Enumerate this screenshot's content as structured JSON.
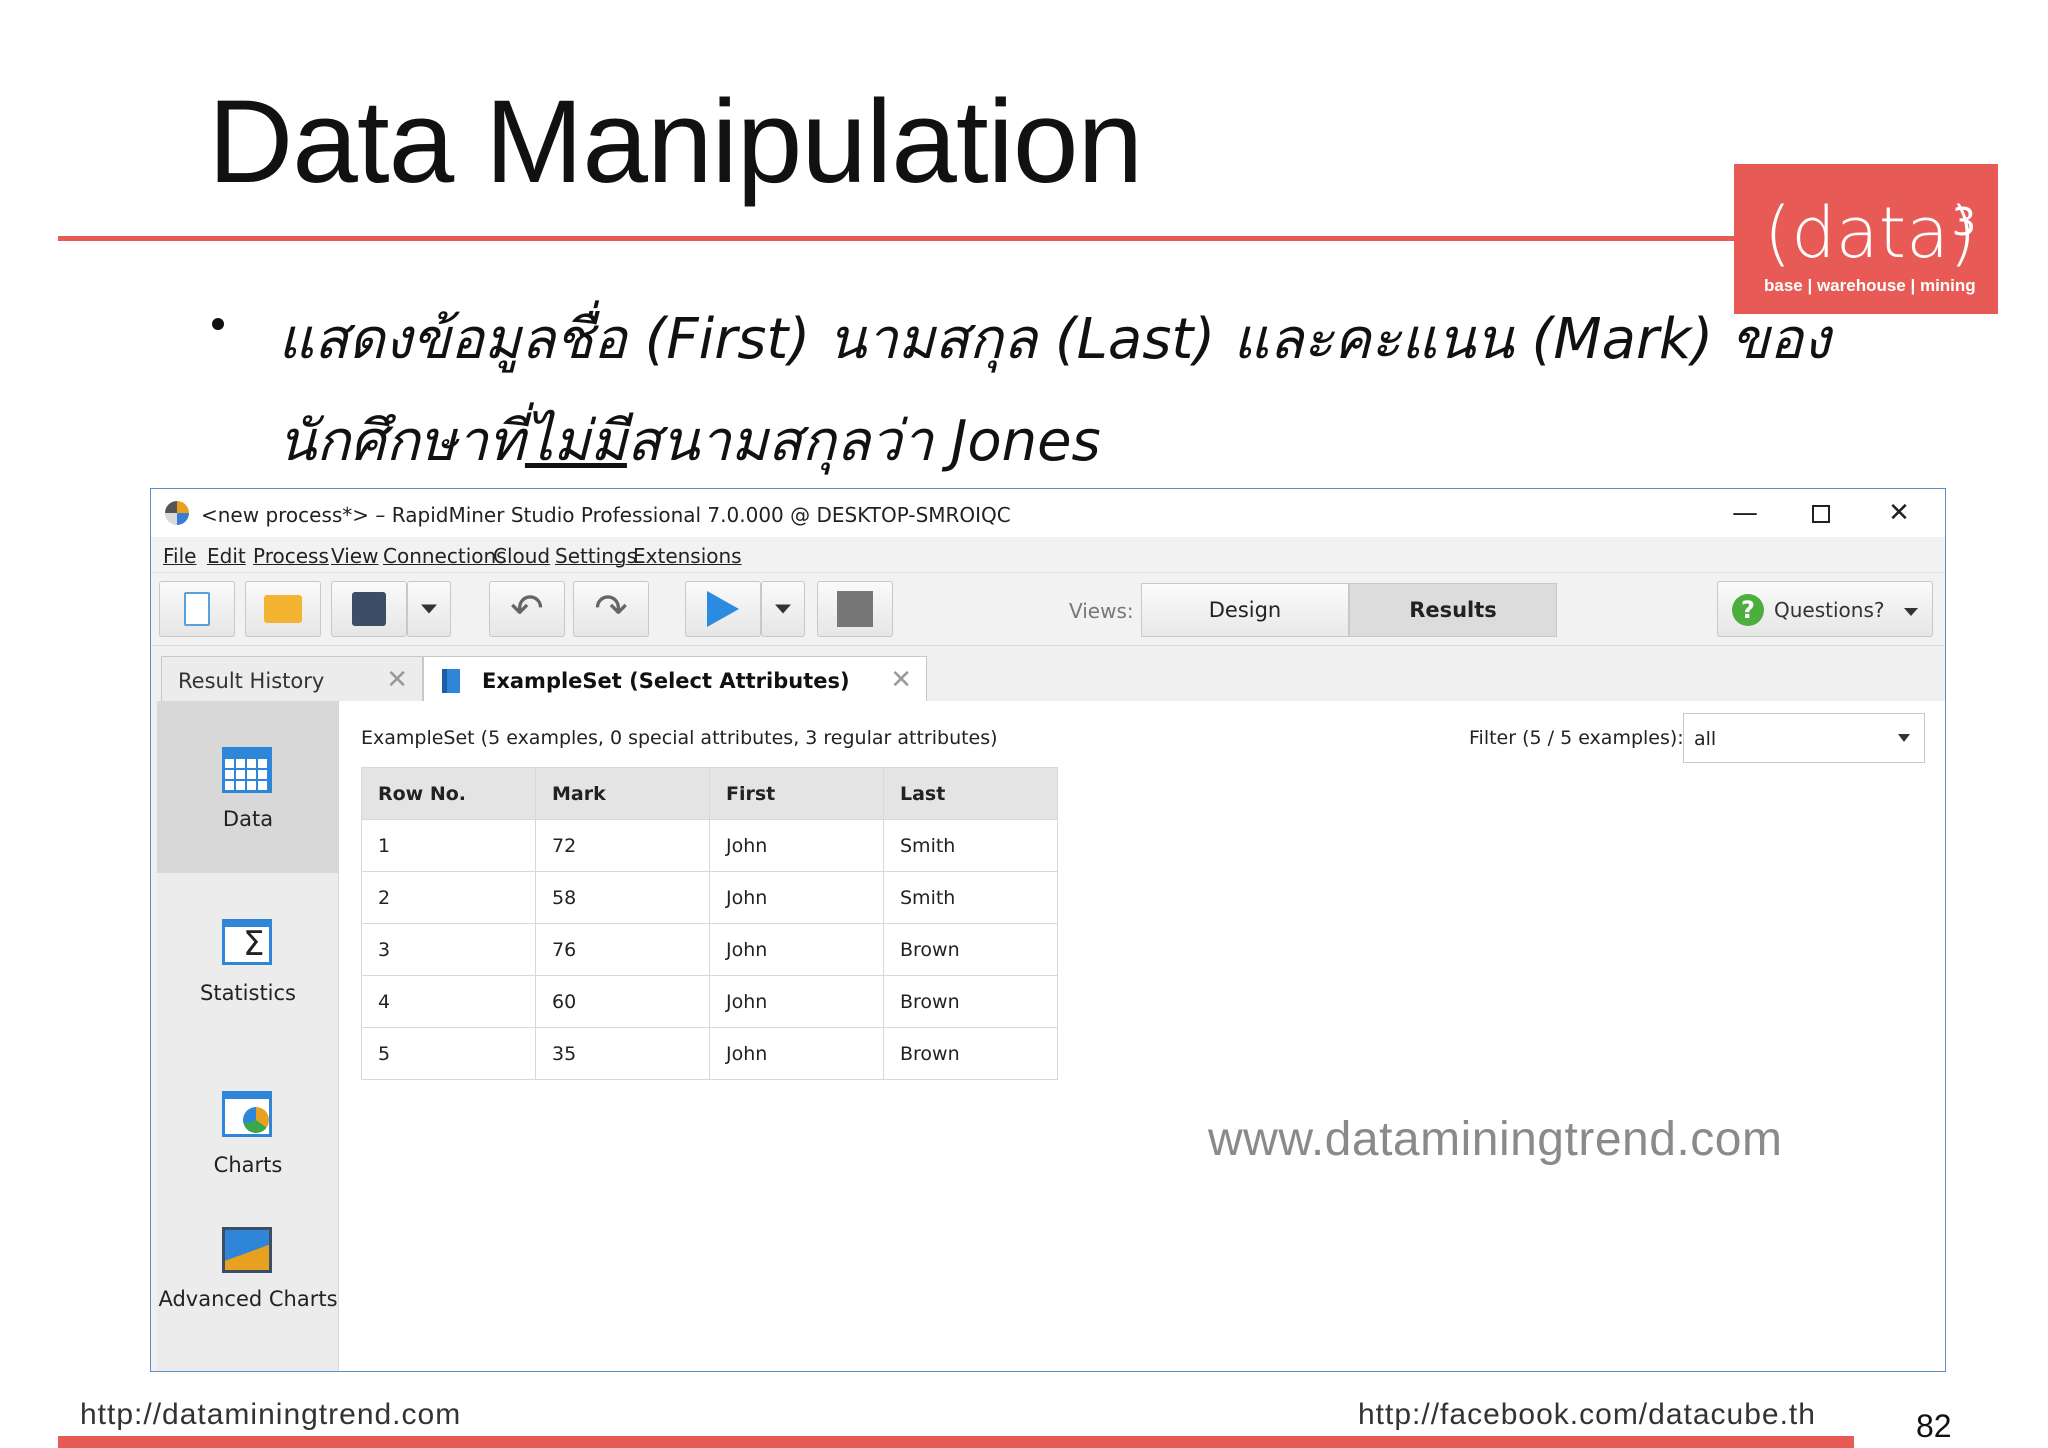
{
  "slide": {
    "title": "Data Manipulation",
    "logo": {
      "main": "(data)",
      "sup": "3",
      "sub": "base | warehouse | mining"
    },
    "bullet_line1": "แสดงข้อมูลชื่อ (First) นามสกุล (Last) และคะแนน (Mark) ของ",
    "bullet_line2_pre": "นักศึกษาที่",
    "bullet_line2_under": "ไม่มี",
    "bullet_line2_post": "สนามสกุลว่า Jones",
    "watermark": "www.dataminingtrend.com",
    "footer_left": "http://dataminingtrend.com",
    "footer_right": "http://facebook.com/datacube.th",
    "page_number": "82",
    "accent_color": "#e85a55"
  },
  "window": {
    "title": "<new process*> – RapidMiner Studio Professional 7.0.000 @ DESKTOP-SMROIQC",
    "controls": {
      "minimize": "—",
      "close": "✕"
    },
    "menu": [
      "File",
      "Edit",
      "Process",
      "View",
      "Connections",
      "Cloud",
      "Settings",
      "Extensions"
    ],
    "toolbar": {
      "undo_glyph": "↶",
      "redo_glyph": "↷",
      "views_label": "Views:",
      "design_label": "Design",
      "results_label": "Results",
      "questions_label": "Questions?",
      "questions_glyph": "?"
    },
    "tabs": {
      "history_label": "Result History",
      "example_label": "ExampleSet (Select Attributes)",
      "close_glyph": "✕"
    },
    "sidebar": [
      {
        "label": "Data",
        "icon": "table-icon"
      },
      {
        "label": "Statistics",
        "icon": "statistics-icon"
      },
      {
        "label": "Charts",
        "icon": "charts-icon"
      },
      {
        "label": "Advanced Charts",
        "icon": "advanced-charts-icon"
      }
    ],
    "content": {
      "description": "ExampleSet (5 examples, 0 special attributes, 3 regular attributes)",
      "filter_label": "Filter (5 / 5 examples):",
      "filter_value": "all",
      "columns": [
        "Row No.",
        "Mark",
        "First",
        "Last"
      ],
      "rows": [
        [
          "1",
          "72",
          "John",
          "Smith"
        ],
        [
          "2",
          "58",
          "John",
          "Smith"
        ],
        [
          "3",
          "76",
          "John",
          "Brown"
        ],
        [
          "4",
          "60",
          "John",
          "Brown"
        ],
        [
          "5",
          "35",
          "John",
          "Brown"
        ]
      ]
    }
  }
}
